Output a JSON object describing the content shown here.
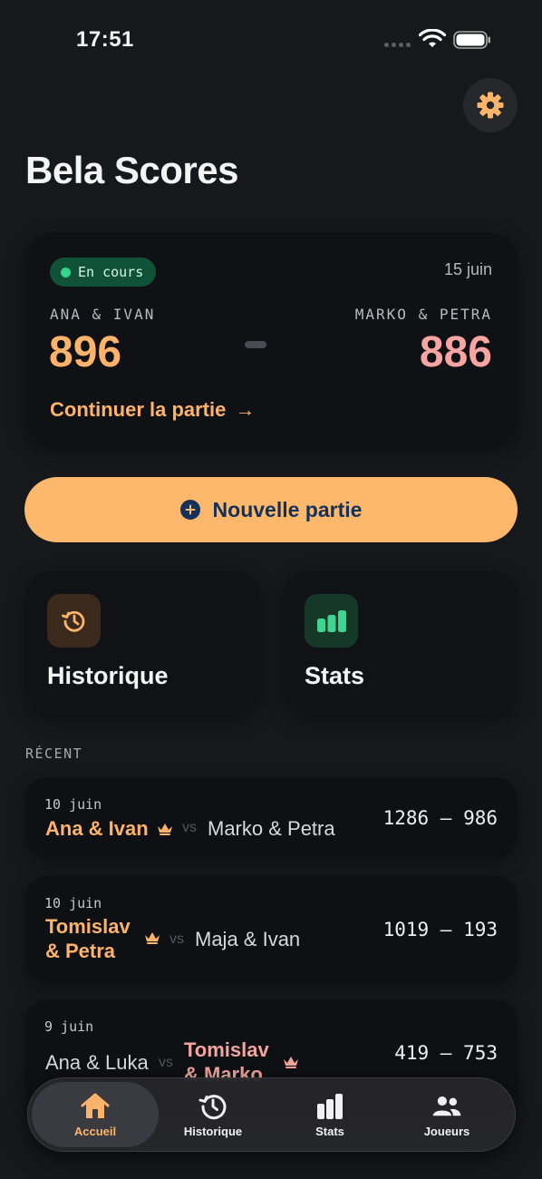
{
  "status_bar": {
    "time": "17:51"
  },
  "header": {
    "title": "Bela Scores"
  },
  "current_game": {
    "status": "En cours",
    "date": "15 juin",
    "team_left": "ANA & IVAN",
    "team_right": "MARKO & PETRA",
    "score_left": "896",
    "score_right": "886",
    "continue_label": "Continuer la partie",
    "continue_arrow": "→"
  },
  "new_game": {
    "label": "Nouvelle partie"
  },
  "tiles": {
    "history": "Historique",
    "stats": "Stats"
  },
  "recent": {
    "title": "RÉCENT",
    "vs": "vs",
    "games": [
      {
        "date": "10 juin",
        "team_a": "Ana & Ivan",
        "team_b": "Marko & Petra",
        "score": "1286 — 986"
      },
      {
        "date": "10 juin",
        "team_a_line1": "Tomislav",
        "team_a_line2": "& Petra",
        "team_b": "Maja & Ivan",
        "score": "1019 — 193"
      },
      {
        "date": "9 juin",
        "team_a": "Ana & Luka",
        "team_b_line1": "Tomislav",
        "team_b_line2": "& Marko",
        "score": "419 — 753"
      }
    ]
  },
  "tab_bar": {
    "items": [
      {
        "label": "Accueil",
        "icon": "home-icon",
        "active": true
      },
      {
        "label": "Historique",
        "icon": "history-icon",
        "active": false
      },
      {
        "label": "Stats",
        "icon": "stats-icon",
        "active": false
      },
      {
        "label": "Joueurs",
        "icon": "players-icon",
        "active": false
      }
    ]
  },
  "colors": {
    "accent": "#fdb46a",
    "accent_pink": "#f6a5a3",
    "background": "#17181b",
    "status_green": "#35d48b"
  }
}
